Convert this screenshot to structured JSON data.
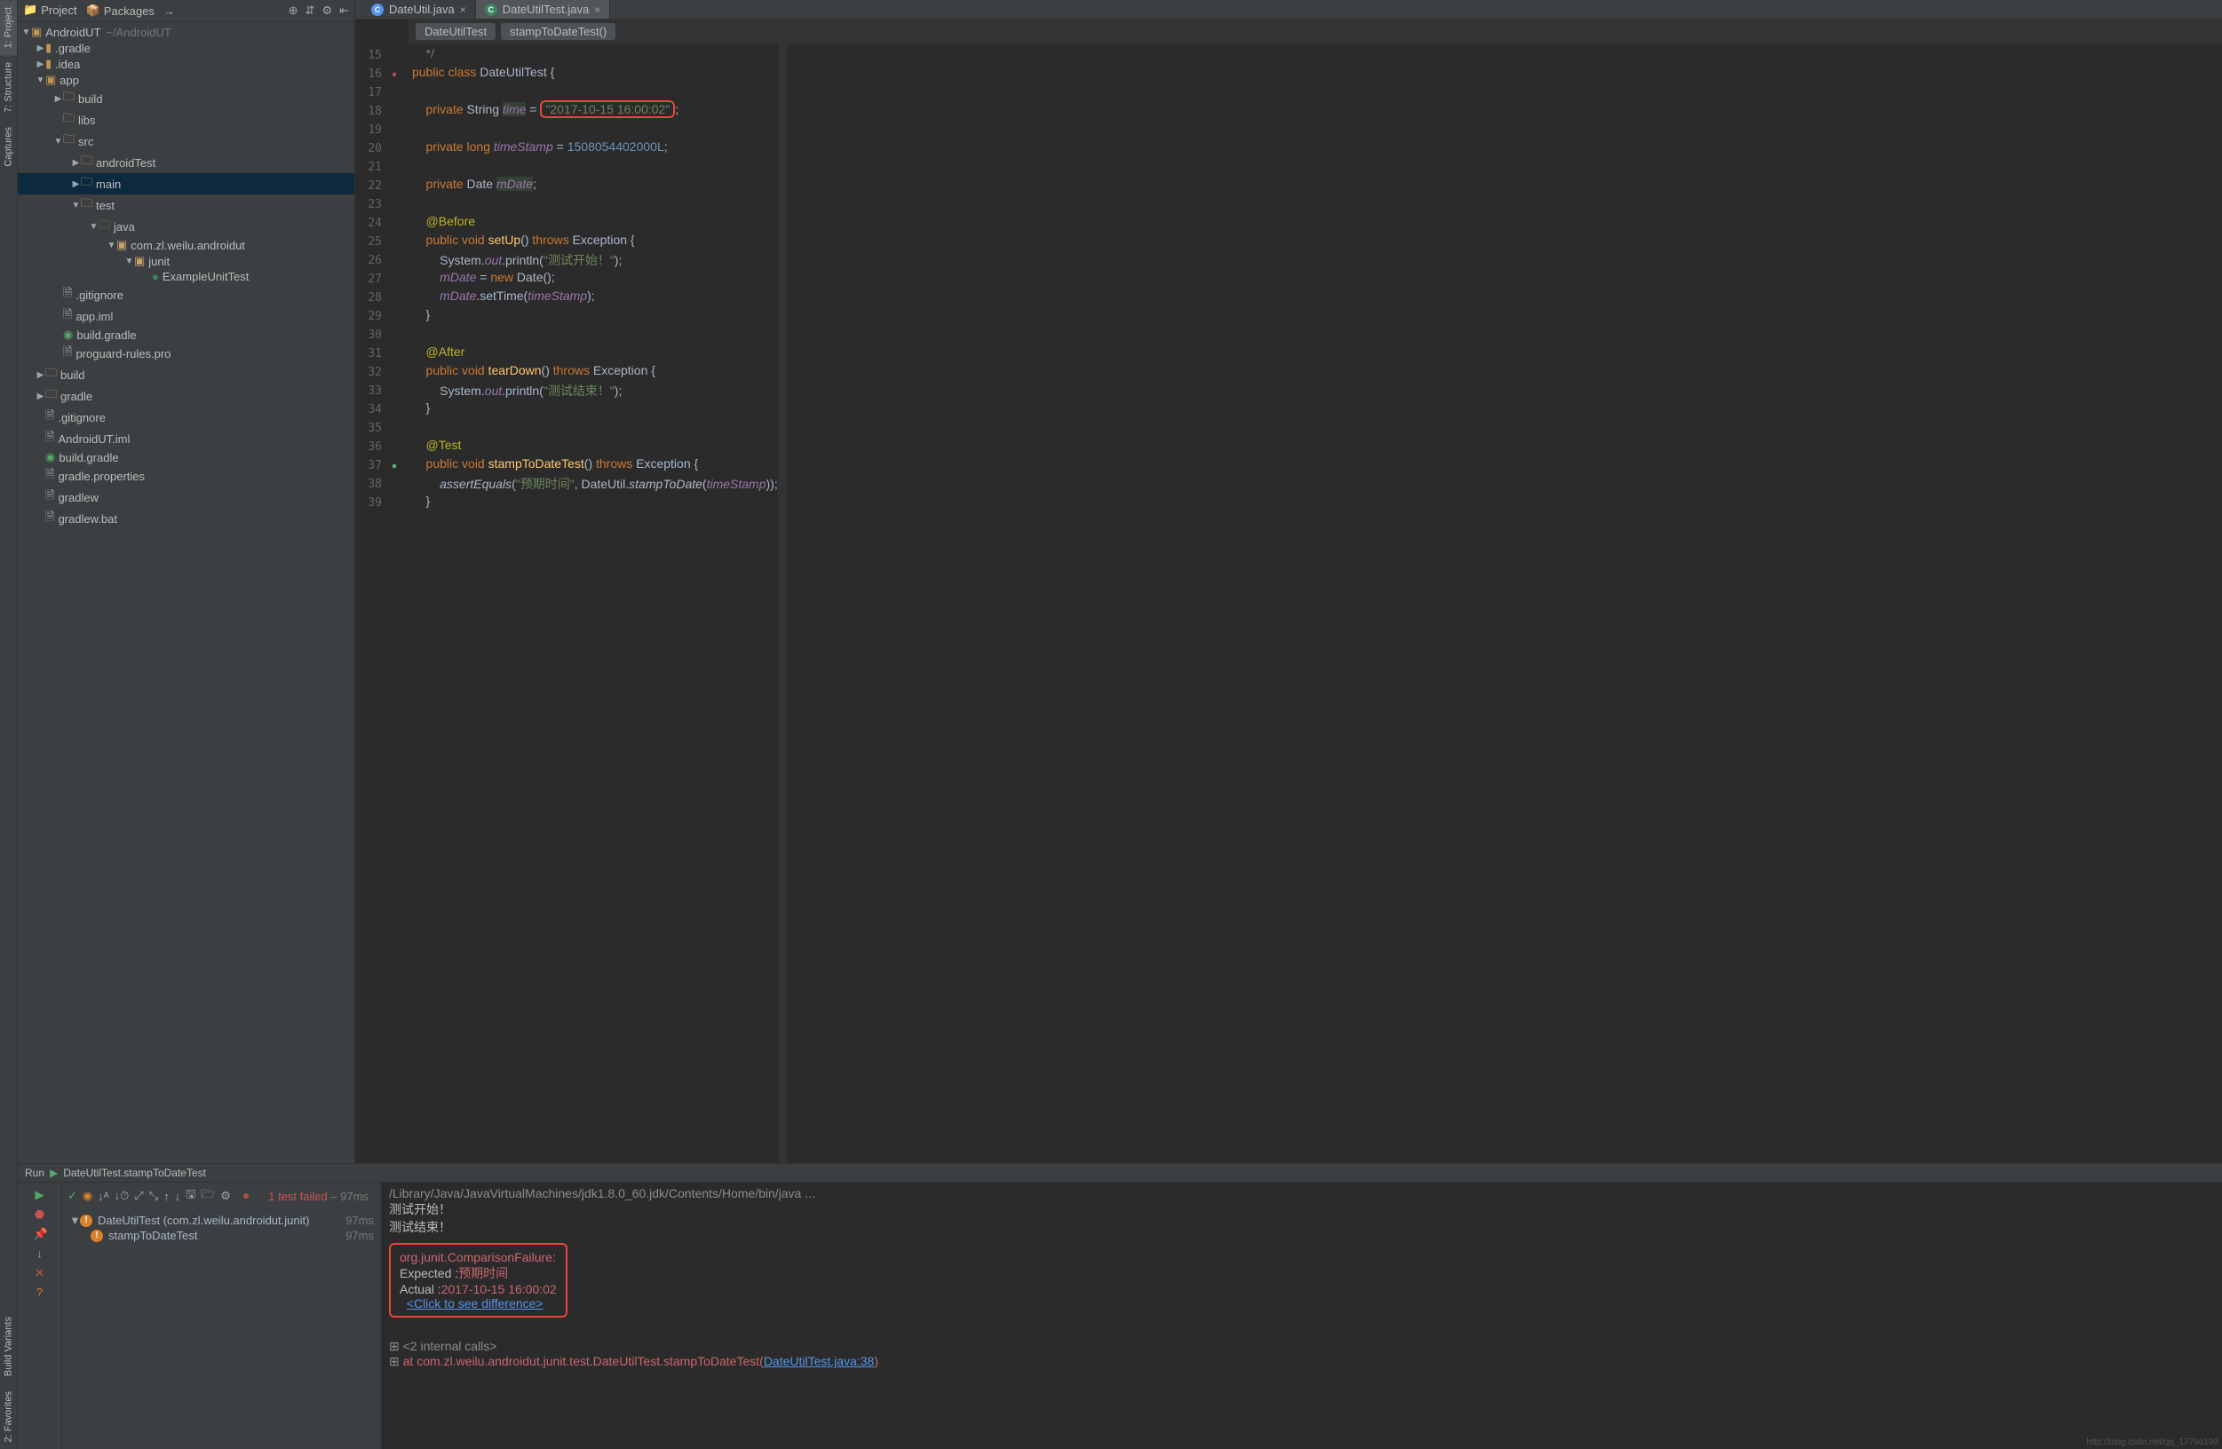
{
  "sideTabs": {
    "project": "1: Project",
    "structure": "7: Structure",
    "captures": "Captures",
    "buildVariants": "Build Variants",
    "favorites": "2: Favorites"
  },
  "panelTabs": {
    "project": "Project",
    "packages": "Packages"
  },
  "projectRoot": {
    "name": "AndroidUT",
    "path": "~/AndroidUT"
  },
  "tree": {
    "gradleDir": ".gradle",
    "idea": ".idea",
    "app": "app",
    "build": "build",
    "libs": "libs",
    "src": "src",
    "androidTest": "androidTest",
    "main": "main",
    "test": "test",
    "java": "java",
    "pkg": "com.zl.weilu.androidut",
    "junit": "junit",
    "exampleUnitTest": "ExampleUnitTest",
    "gitignore": ".gitignore",
    "appIml": "app.iml",
    "buildGradle": "build.gradle",
    "proguard": "proguard-rules.pro",
    "rootBuild": "build",
    "rootGradle": "gradle",
    "androidUtIml": "AndroidUT.iml",
    "gradleProps": "gradle.properties",
    "gradlew": "gradlew",
    "gradlewBat": "gradlew.bat"
  },
  "editorTabs": {
    "t1": "DateUtil.java",
    "t2": "DateUtilTest.java"
  },
  "breadcrumb": {
    "a": "DateUtilTest",
    "b": "stampToDateTest()"
  },
  "code": {
    "l15": "    */",
    "l16a": "public class ",
    "l16b": "DateUtilTest {",
    "l18a": "    private ",
    "l18b": "String ",
    "l18c": "time",
    "l18d": " = ",
    "l18e": "\"2017-10-15 16:00:02\"",
    "l18f": ";",
    "l20a": "    private long ",
    "l20b": "timeStamp",
    "l20c": " = ",
    "l20d": "1508054402000L",
    "l20e": ";",
    "l22a": "    private ",
    "l22b": "Date ",
    "l22c": "mDate",
    "l22d": ";",
    "l24": "    @Before",
    "l25a": "    public void ",
    "l25b": "setUp",
    "l25c": "() ",
    "l25d": "throws ",
    "l25e": "Exception {",
    "l26a": "        System.",
    "l26b": "out",
    "l26c": ".println(",
    "l26d": "\"测试开始！\"",
    "l26e": ");",
    "l27a": "        ",
    "l27b": "mDate",
    "l27c": " = ",
    "l27d": "new ",
    "l27e": "Date();",
    "l28a": "        ",
    "l28b": "mDate",
    "l28c": ".setTime(",
    "l28d": "timeStamp",
    "l28e": ");",
    "l29": "    }",
    "l31": "    @After",
    "l32a": "    public void ",
    "l32b": "tearDown",
    "l32c": "() ",
    "l32d": "throws ",
    "l32e": "Exception {",
    "l33a": "        System.",
    "l33b": "out",
    "l33c": ".println(",
    "l33d": "\"测试结束！\"",
    "l33e": ");",
    "l34": "    }",
    "l36": "    @Test",
    "l37a": "    public void ",
    "l37b": "stampToDateTest",
    "l37c": "() ",
    "l37d": "throws ",
    "l37e": "Exception {",
    "l38a": "        ",
    "l38b": "assertEquals",
    "l38c": "(",
    "l38d": "\"预期时间\"",
    "l38e": ", DateUtil.",
    "l38f": "stampToDate",
    "l38g": "(",
    "l38h": "timeStamp",
    "l38i": "));",
    "l39": "    }"
  },
  "lineNumbers": [
    "15",
    "16",
    "17",
    "18",
    "19",
    "20",
    "21",
    "22",
    "23",
    "24",
    "25",
    "26",
    "27",
    "28",
    "29",
    "30",
    "31",
    "32",
    "33",
    "34",
    "35",
    "36",
    "37",
    "38",
    "39"
  ],
  "run": {
    "header": "Run",
    "config": "DateUtilTest.stampToDateTest",
    "statusFail": "1 test failed",
    "statusDur": "– 97ms",
    "testClass": "DateUtilTest (com.zl.weilu.androidut.junit)",
    "testClassDur": "97ms",
    "testMethod": "stampToDateTest",
    "testMethodDur": "97ms"
  },
  "console": {
    "javaPath": "/Library/Java/JavaVirtualMachines/jdk1.8.0_60.jdk/Contents/Home/bin/java ...",
    "startMsg": "测试开始！",
    "endMsg": "测试结束！",
    "failureType": "org.junit.ComparisonFailure:",
    "expectedLabel": "Expected :",
    "expectedVal": "预期时间",
    "actualLabel": "Actual   :",
    "actualVal": "2017-10-15 16:00:02",
    "diffLink": "<Click to see difference>",
    "internalCalls": "<2 internal calls>",
    "atPrefix": "    at ",
    "atPkg": "com.zl.weilu.androidut.junit.test.DateUtilTest.stampToDateTest(",
    "atLink": "DateUtilTest.java:38",
    "atClose": ")",
    "watermark": "http://blog.csdn.net/qq_17766199"
  }
}
